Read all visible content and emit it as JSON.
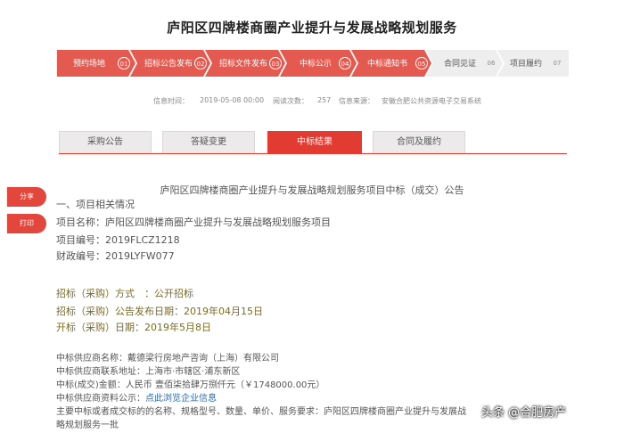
{
  "title": "庐阳区四牌楼商圈产业提升与发展战略规划服务",
  "steps": [
    {
      "label": "预约场地",
      "num": "01",
      "state": "active"
    },
    {
      "label": "招标公告发布",
      "num": "02",
      "state": "active"
    },
    {
      "label": "招标文件发布",
      "num": "03",
      "state": "active"
    },
    {
      "label": "中标公示",
      "num": "04",
      "state": "active"
    },
    {
      "label": "中标通知书",
      "num": "05",
      "state": "active"
    },
    {
      "label": "合同见证",
      "num": "06",
      "state": "gray"
    },
    {
      "label": "项目履约",
      "num": "07",
      "state": "gray"
    }
  ],
  "meta": {
    "time_label": "信息时间：",
    "time_value": "2019-05-08 00:00",
    "views_label": "阅读次数：",
    "views_value": "257",
    "source_label": "信息来源：",
    "source_value": "安徽合肥公共资源电子交易系统"
  },
  "tabs": [
    {
      "label": "采购公告"
    },
    {
      "label": "答疑变更"
    },
    {
      "label": "中标结果"
    },
    {
      "label": "合同及履约"
    }
  ],
  "side": {
    "share": "分享",
    "print": "打印"
  },
  "announcement": {
    "title": "庐阳区四牌楼商圈产业提升与发展战略规划服务项目中标（成交）公告",
    "section1": "一、项目相关情况",
    "project_name": "项目名称：庐阳区四牌楼商圈产业提升与发展战略规划服务项目",
    "project_no": "项目编号：2019FLCZ1218",
    "finance_no": "财政编号：2019LYFW077",
    "method": "招标（采购）方式　：公开招标",
    "publish_date": "招标（采购）公告发布日期：2019年04月15日",
    "open_date": "开标（采购）日期：2019年5月8日",
    "supplier_name": "中标供应商名称：戴德梁行房地产咨询（上海）有限公司",
    "supplier_addr": "中标供应商联系地址：上海市·市辖区·浦东新区",
    "amount": "中标(成交)金额：人民币 壹佰柒拾肆万捌仟元（￥1748000.00元）",
    "info_label": "中标供应商资料公示：",
    "info_link": "点此浏览企业信息",
    "main_req_1": "主要中标或者成交标的的名称、规格型号、数量、单价、服务要求：庐阳区四牌楼商圈产业提升与发展战",
    "main_req_2": "略规划服务一批"
  },
  "watermark": "头条 @合肥房产",
  "colors": {
    "accent": "#e23b32",
    "olive": "#7a6a2b",
    "link": "#2a6bb5"
  }
}
